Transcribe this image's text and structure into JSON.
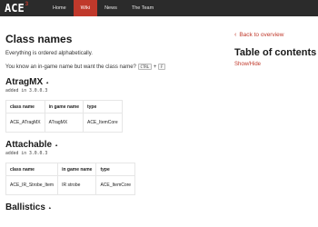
{
  "header": {
    "logo_text": "ACE",
    "logo_sup": "3",
    "nav": [
      "Home",
      "Wiki",
      "News",
      "The Team"
    ],
    "active_index": 1
  },
  "main": {
    "title": "Class names",
    "intro": "Everything is ordered alphabetically.",
    "hint": "You know an in-game name but want the class name?",
    "kbd1": "CTRL",
    "plus": "+",
    "kbd2": "F",
    "sections": [
      {
        "title": "AtragMX",
        "added": "added in 3.0.0.3",
        "headers": [
          "class name",
          "in game name",
          "type"
        ],
        "rows": [
          [
            "ACE_ATragMX",
            "ATragMX",
            "ACE_ItemCore"
          ]
        ]
      },
      {
        "title": "Attachable",
        "added": "added in 3.0.0.3",
        "headers": [
          "class name",
          "in game name",
          "type"
        ],
        "rows": [
          [
            "ACE_IR_Strobe_Item",
            "IR strobe",
            "ACE_ItemCore"
          ]
        ]
      },
      {
        "title": "Ballistics"
      }
    ]
  },
  "sidebar": {
    "back_label": "Back to overview",
    "toc_title": "Table of contents",
    "toc_toggle": "Show/Hide"
  },
  "colors": {
    "accent": "#c0392b",
    "topbar": "#2b2b2b"
  }
}
